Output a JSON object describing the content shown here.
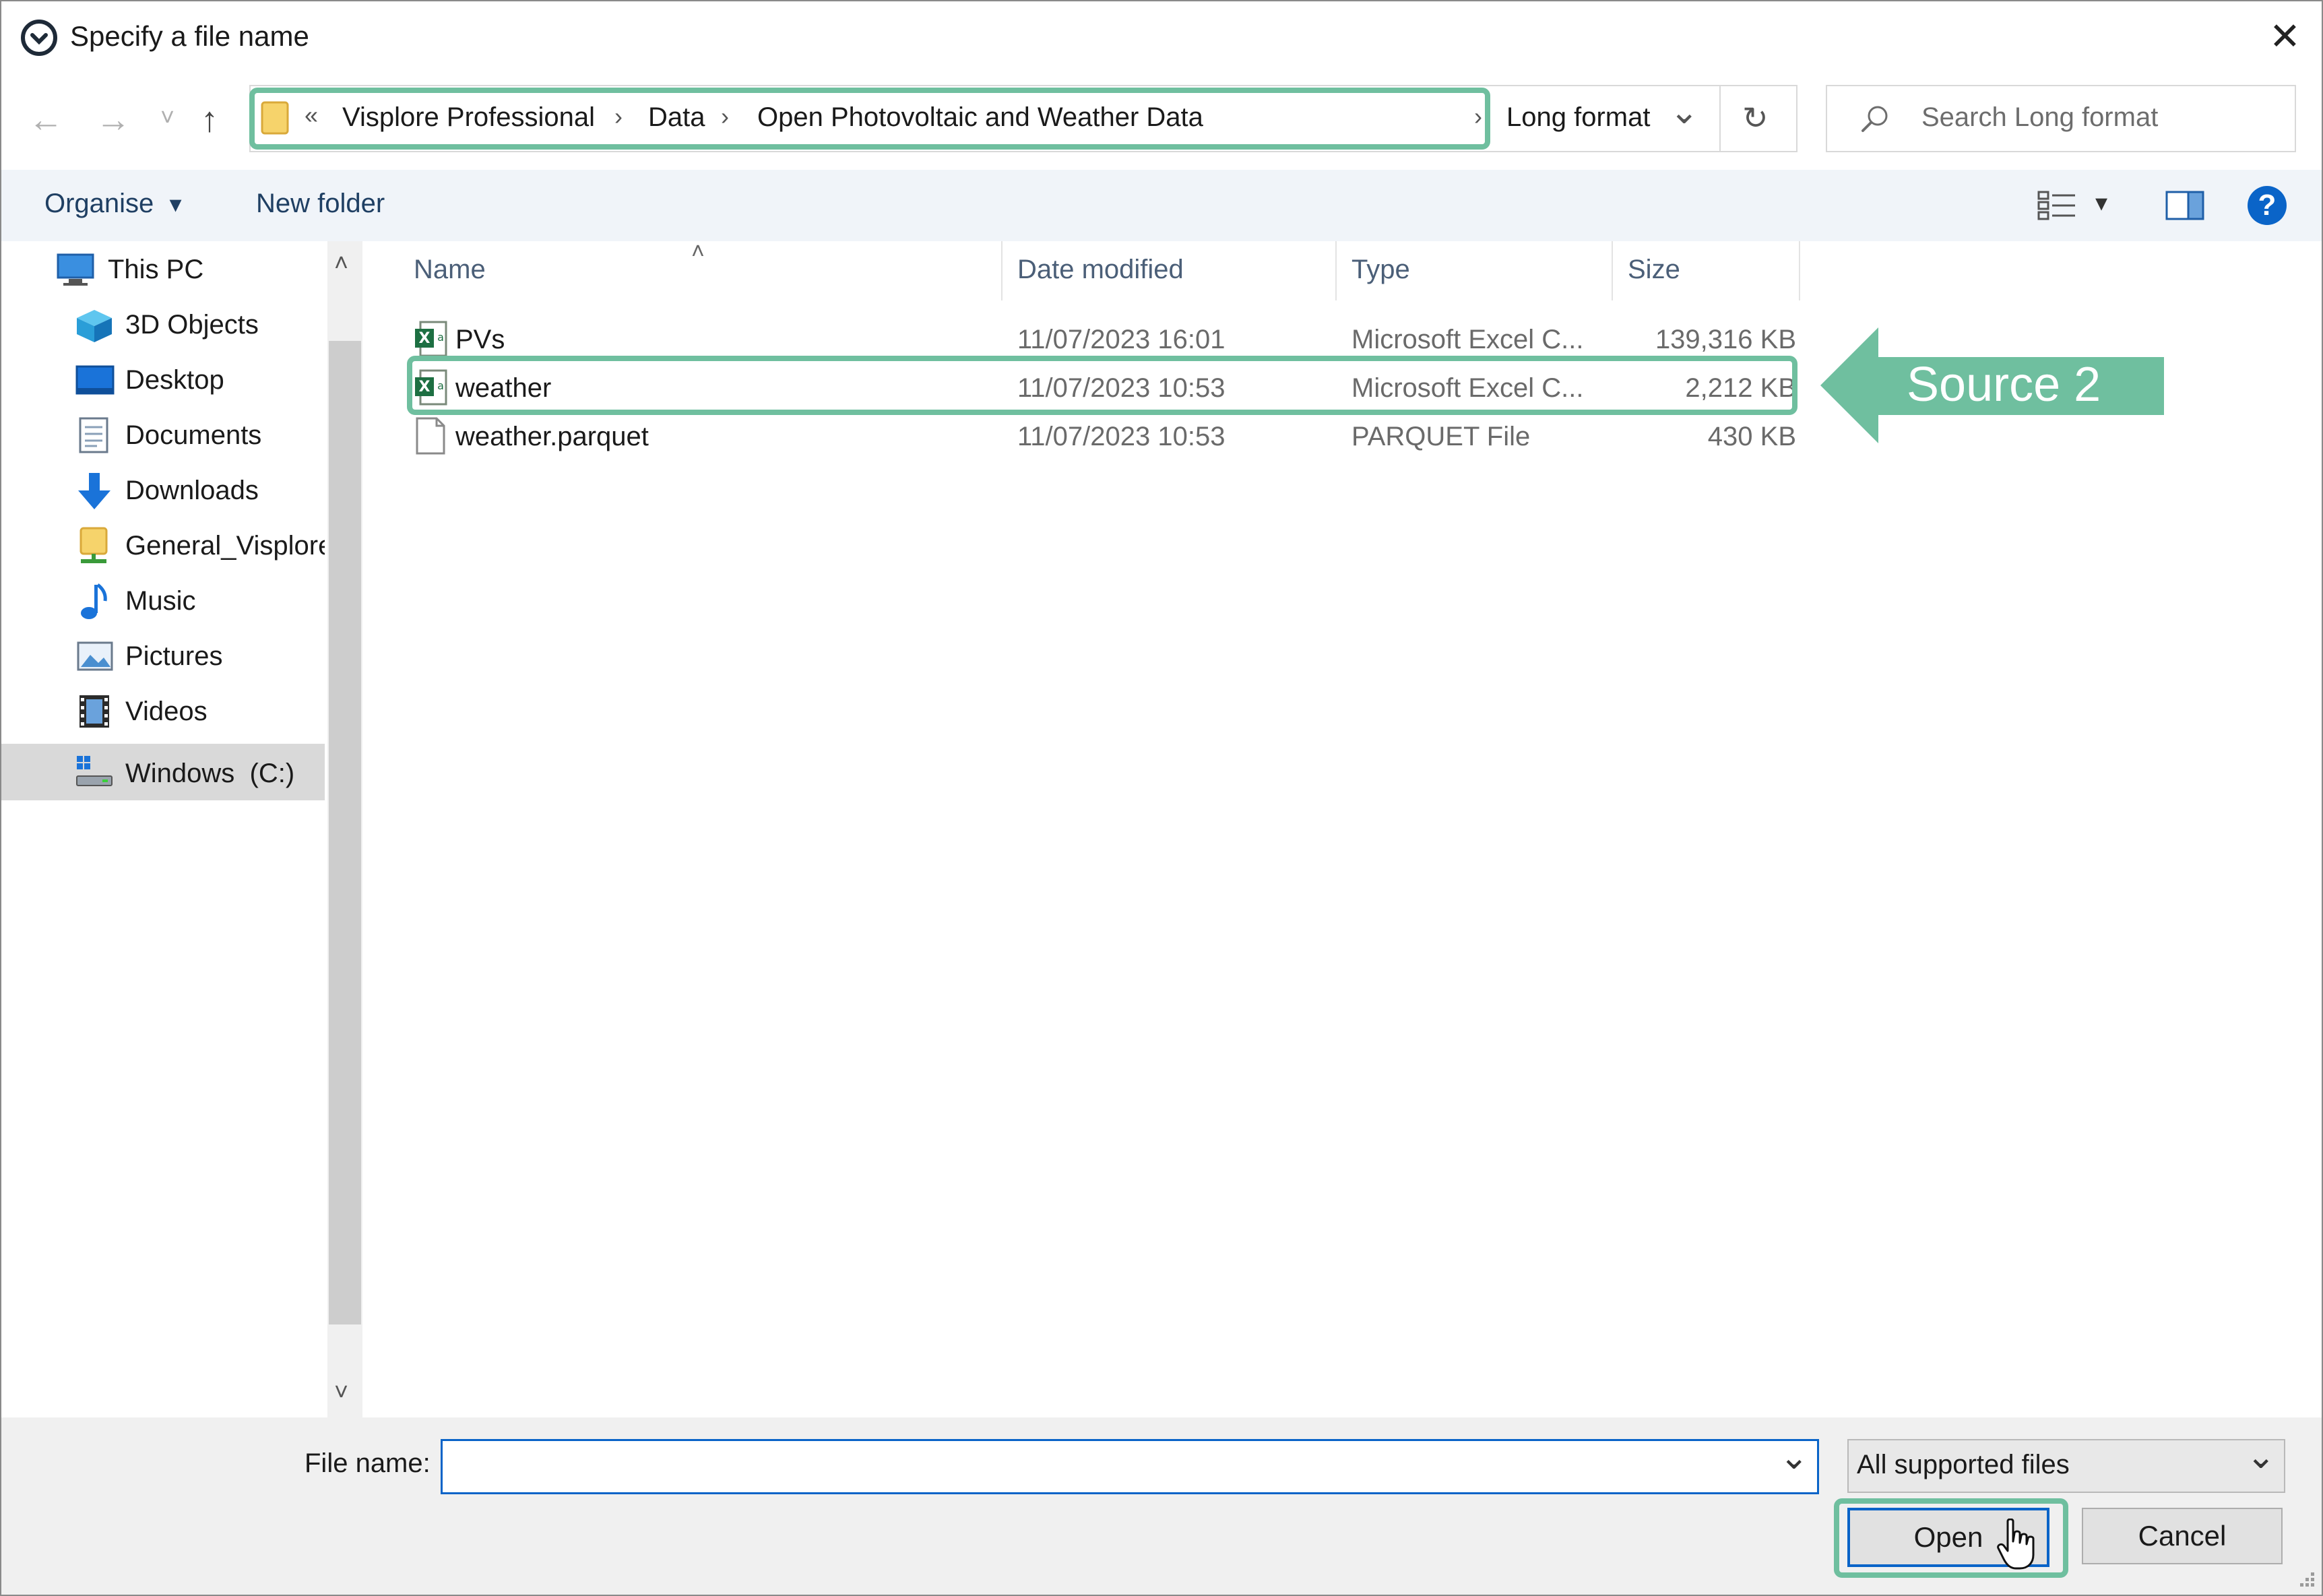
{
  "window": {
    "title": "Specify a file name",
    "close_glyph": "✕",
    "title_icon": "app-logo-icon"
  },
  "nav": {
    "back_glyph": "←",
    "forward_glyph": "→",
    "recent_glyph": "˅",
    "up_glyph": "↑",
    "overflow": "«",
    "breadcrumbs": [
      "Visplore Professional",
      "Data",
      "Open Photovoltaic and Weather Data",
      "Long format"
    ],
    "separator": "›",
    "dropdown_glyph": "⌄",
    "refresh_glyph": "↻",
    "search_placeholder": "Search Long format"
  },
  "toolbar": {
    "organise": "Organise",
    "organise_caret": "▾",
    "new_folder": "New folder",
    "view_caret": "▾",
    "help": "?"
  },
  "sidebar": {
    "items": [
      {
        "label": "This PC",
        "icon": "computer-icon"
      },
      {
        "label": "3D Objects",
        "icon": "cube-icon"
      },
      {
        "label": "Desktop",
        "icon": "desktop-icon"
      },
      {
        "label": "Documents",
        "icon": "document-icon"
      },
      {
        "label": "Downloads",
        "icon": "download-arrow-icon"
      },
      {
        "label": "General_Visplore",
        "icon": "network-folder-icon"
      },
      {
        "label": "Music",
        "icon": "music-note-icon"
      },
      {
        "label": "Pictures",
        "icon": "pictures-icon"
      },
      {
        "label": "Videos",
        "icon": "film-icon"
      },
      {
        "label": "Windows  (C:)",
        "icon": "drive-icon"
      }
    ],
    "selected_index": 9,
    "scroll_up": "˄",
    "scroll_down": "˅"
  },
  "list": {
    "sort_glyph": "˄",
    "columns": [
      "Name",
      "Date modified",
      "Type",
      "Size"
    ],
    "rows": [
      {
        "name": "PVs",
        "date": "11/07/2023 16:01",
        "type": "Microsoft Excel C...",
        "size": "139,316 KB",
        "icon": "excel-csv-icon"
      },
      {
        "name": "weather",
        "date": "11/07/2023 10:53",
        "type": "Microsoft Excel C...",
        "size": "2,212 KB",
        "icon": "excel-csv-icon"
      },
      {
        "name": "weather.parquet",
        "date": "11/07/2023 10:53",
        "type": "PARQUET File",
        "size": "430 KB",
        "icon": "blank-file-icon"
      }
    ]
  },
  "bottom": {
    "file_name_label": "File name:",
    "file_name_value": "",
    "file_type": "All supported files",
    "dropdown_glyph": "⌄",
    "open": "Open",
    "cancel": "Cancel"
  },
  "annotation": {
    "callout": "Source 2",
    "color": "#6fbf9f"
  },
  "colors": {
    "accent": "#0a64c8",
    "toolbar_bg": "#f0f4f9",
    "highlight": "#6fbf9f"
  }
}
